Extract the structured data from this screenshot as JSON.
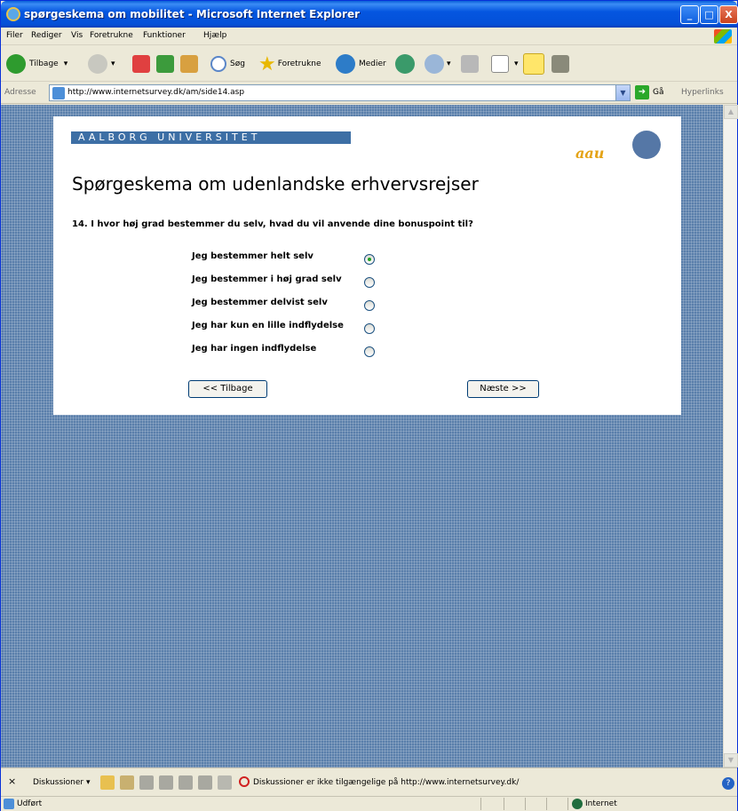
{
  "window": {
    "title": "spørgeskema om mobilitet - Microsoft Internet Explorer",
    "min": "_",
    "max": "□",
    "close": "X"
  },
  "menu": [
    "Filer",
    "Rediger",
    "Vis",
    "Foretrukne",
    "Funktioner",
    "Hjælp"
  ],
  "toolbar": {
    "back": "Tilbage",
    "search": "Søg",
    "favorites": "Foretrukne",
    "media": "Medier"
  },
  "address": {
    "label": "Adresse",
    "url": "http://www.internetsurvey.dk/am/side14.asp",
    "go": "Gå",
    "links": "Hyperlinks"
  },
  "page": {
    "banner": "AALBORG UNIVERSITET",
    "logo_text": "aau",
    "heading": "Spørgeskema om udenlandske erhvervsrejser",
    "question": "14. I hvor høj grad bestemmer du selv, hvad du vil anvende dine bonuspoint til?",
    "options": [
      {
        "label": "Jeg bestemmer helt selv",
        "checked": true
      },
      {
        "label": "Jeg bestemmer i høj grad selv",
        "checked": false
      },
      {
        "label": "Jeg bestemmer delvist selv",
        "checked": false
      },
      {
        "label": "Jeg har kun en lille indflydelse",
        "checked": false
      },
      {
        "label": "Jeg har ingen indflydelse",
        "checked": false
      }
    ],
    "back_button": "<< Tilbage",
    "next_button": "Næste >>"
  },
  "discussions": {
    "close": "×",
    "label": "Diskussioner ▾",
    "message": "Diskussioner er ikke tilgængelige på http://www.internetsurvey.dk/"
  },
  "status": {
    "text": "Udført",
    "zone": "Internet"
  }
}
